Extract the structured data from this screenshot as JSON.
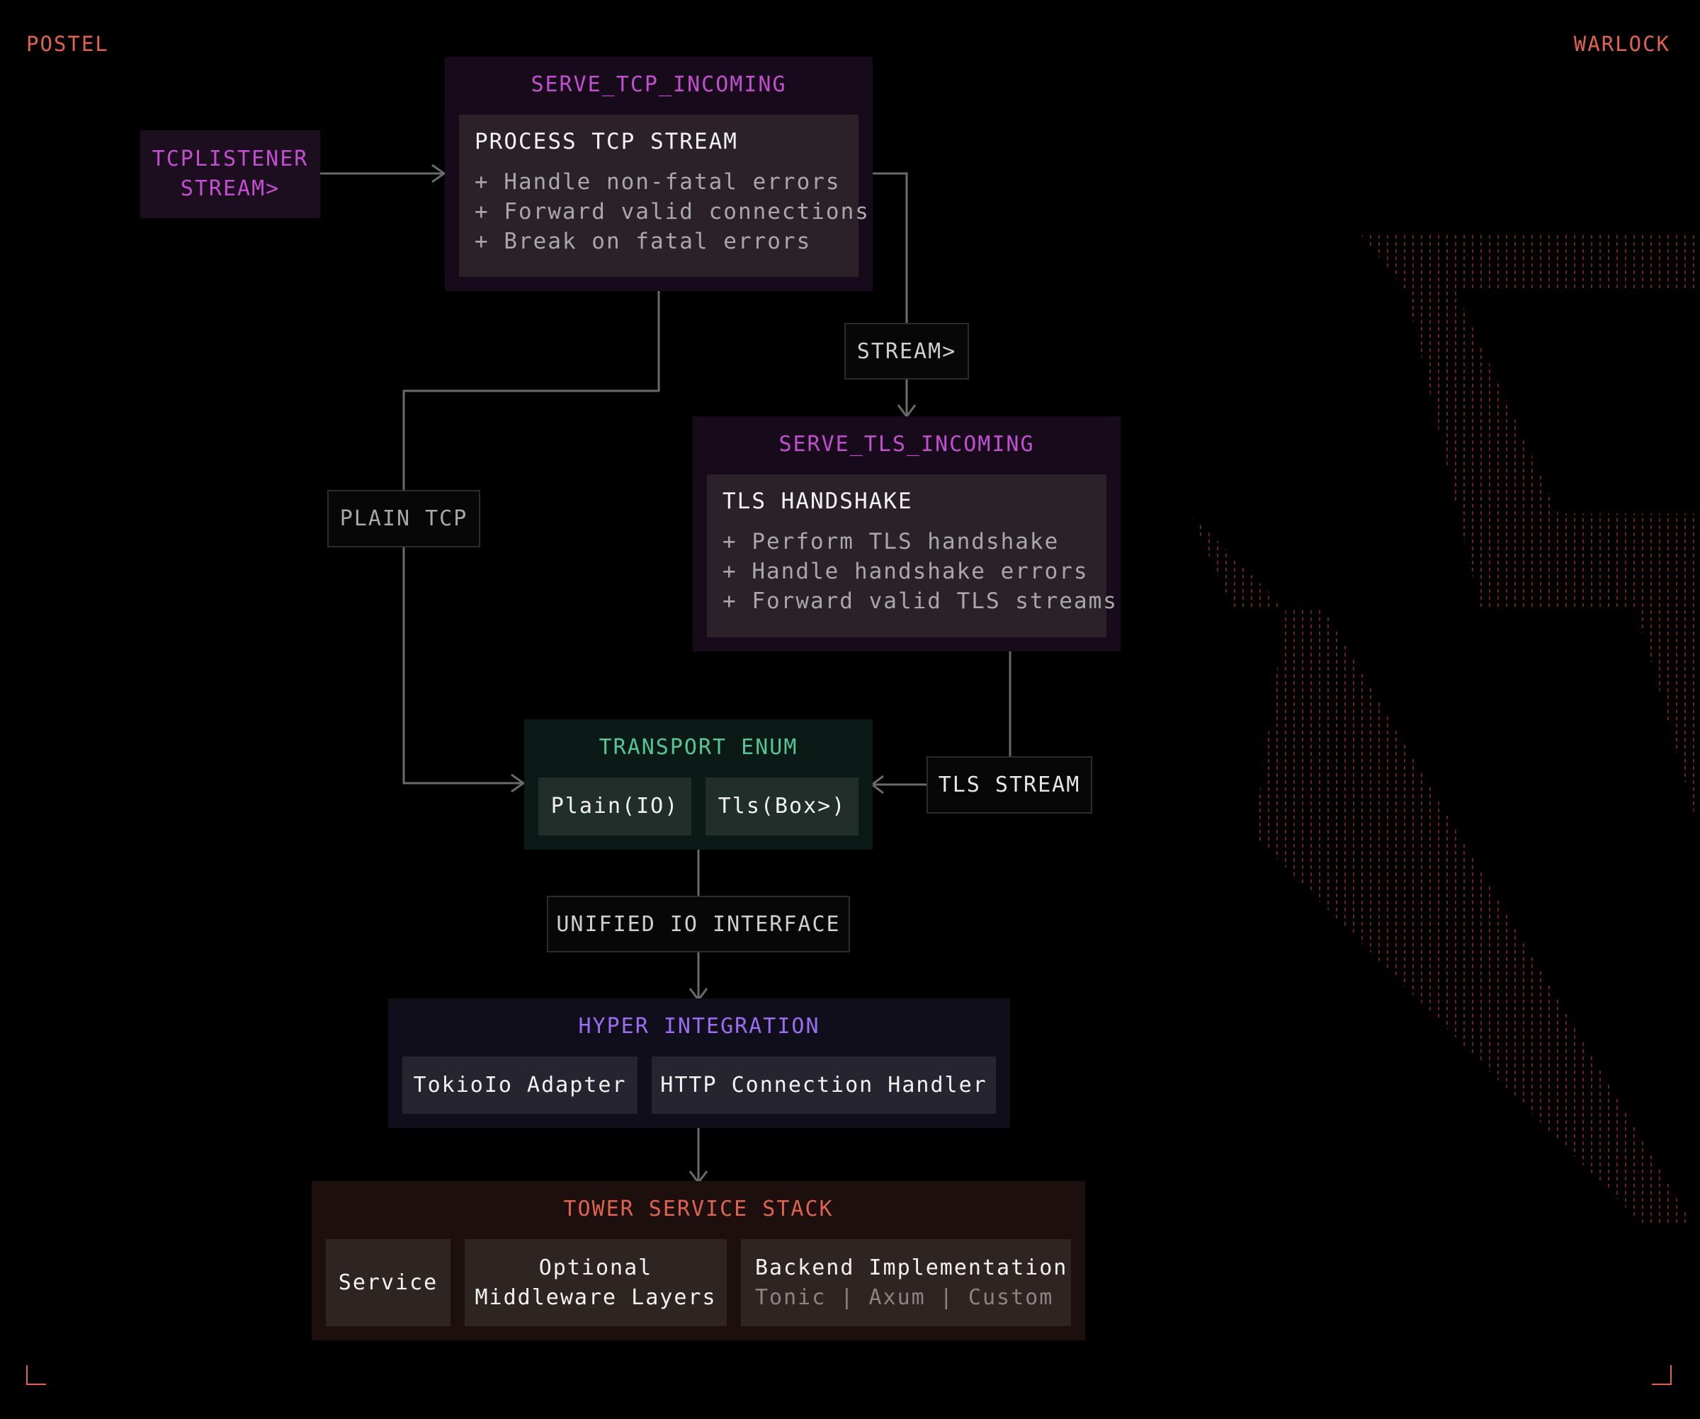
{
  "corners": {
    "left": "POSTEL",
    "right": "WARLOCK"
  },
  "listener": {
    "line1": "TCPLISTENER",
    "line2": "STREAM>"
  },
  "serve_tcp": {
    "title": "SERVE_TCP_INCOMING",
    "panel_title": "PROCESS TCP STREAM",
    "bullets": [
      "+ Handle non-fatal errors",
      "+ Forward valid connections",
      "+ Break on fatal errors"
    ]
  },
  "labels": {
    "stream": "STREAM>",
    "plain_tcp": "PLAIN TCP",
    "tls_stream": "TLS STREAM",
    "unified": "UNIFIED IO INTERFACE"
  },
  "serve_tls": {
    "title": "SERVE_TLS_INCOMING",
    "panel_title": "TLS HANDSHAKE",
    "bullets": [
      "+ Perform TLS handshake",
      "+ Handle handshake errors",
      "+ Forward valid TLS streams"
    ]
  },
  "transport": {
    "title": "TRANSPORT ENUM",
    "plain": "Plain(IO)",
    "tls": "Tls(Box>)"
  },
  "hyper": {
    "title": "HYPER INTEGRATION",
    "adapter": "TokioIo Adapter",
    "handler": "HTTP Connection Handler"
  },
  "tower": {
    "title": "TOWER SERVICE STACK",
    "service": "Service",
    "middleware_line1": "Optional",
    "middleware_line2": "Middleware Layers",
    "backend_line1": "Backend Implementation",
    "backend_line2": "Tonic | Axum | Custom"
  },
  "colors": {
    "accent_red": "#e0624f",
    "tcp_purple": "#c24fd0",
    "transport_green": "#56c596",
    "hyper_violet": "#9a6ef0",
    "tower_red": "#e0624f"
  }
}
